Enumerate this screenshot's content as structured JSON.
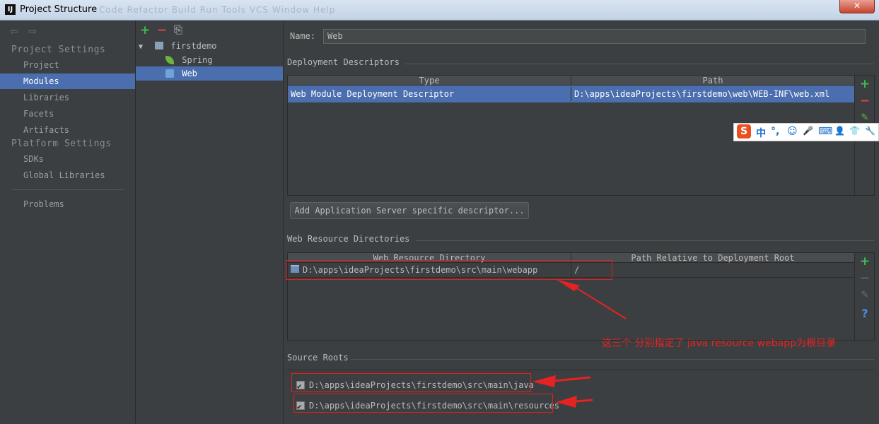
{
  "window": {
    "title": "Project Structure",
    "icon": "IJ",
    "ghost_menu": "Code  Refactor  Build  Run  Tools  VCS  Window  Help",
    "close": "✕"
  },
  "nav": {
    "back_icon": "⇦",
    "forward_icon": "⇨",
    "project_settings": "Project Settings",
    "platform_settings": "Platform Settings",
    "items": [
      "Project",
      "Modules",
      "Libraries",
      "Facets",
      "Artifacts"
    ],
    "platform_items": [
      "SDKs",
      "Global Libraries"
    ],
    "problems": "Problems"
  },
  "tree": {
    "toolbar": {
      "add": "+",
      "remove": "−",
      "copy": "⎘"
    },
    "root": "firstdemo",
    "children": [
      "Spring",
      "Web"
    ]
  },
  "name_label": "Name:",
  "name_value": "Web",
  "deployment": {
    "title": "Deployment Descriptors",
    "col_type": "Type",
    "col_path": "Path",
    "row_type": "Web Module Deployment Descriptor",
    "row_path": "D:\\apps\\ideaProjects\\firstdemo\\web\\WEB-INF\\web.xml",
    "add_server_button": "Add Application Server specific descriptor..."
  },
  "web_resources": {
    "title": "Web Resource Directories",
    "col_dir": "Web Resource Directory",
    "col_rel": "Path Relative to Deployment Root",
    "row_dir": "D:\\apps\\ideaProjects\\firstdemo\\src\\main\\webapp",
    "row_rel": "/"
  },
  "source_roots": {
    "title": "Source Roots",
    "items": [
      "D:\\apps\\ideaProjects\\firstdemo\\src\\main\\java",
      "D:\\apps\\ideaProjects\\firstdemo\\src\\main\\resources"
    ]
  },
  "annotation": "这三个 分别指定了  java resource    webapp为根目录",
  "ime_toolbar": [
    "S",
    "中",
    "°,",
    "☺",
    "🎤",
    "⌨",
    "👤",
    "👕",
    "🔧"
  ],
  "colors": {
    "accent": "#4b6eaf",
    "add": "#3fb950",
    "remove": "#e0463b",
    "annotation": "#e62222"
  }
}
